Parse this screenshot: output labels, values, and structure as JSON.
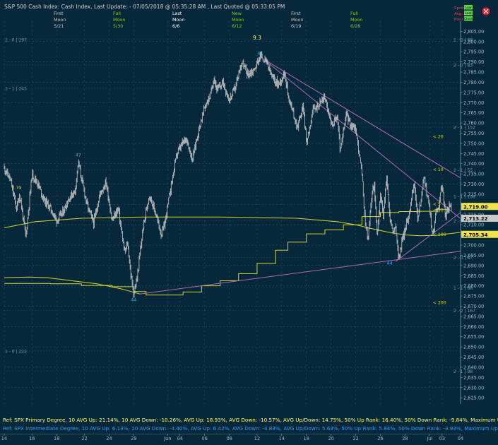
{
  "header": {
    "title": "S&P 500 Cash Index:  Cash Index,  Last Update:  - 07/05/2018 @ 05:35:28 AM , Last Quoted @ 05:33:05 PM",
    "phases": [
      {
        "top": "First",
        "mid": "Moon",
        "date": "5/21",
        "color": "#c9c9c9"
      },
      {
        "top": "Full",
        "mid": "Moon",
        "date": "5/30",
        "color": "#7ed321"
      },
      {
        "top": "Last",
        "mid": "Moon",
        "date": "6/6",
        "color": "#ffffff"
      },
      {
        "top": "New",
        "mid": "Moon",
        "date": "6/12",
        "color": "#7ed321"
      },
      {
        "top": "First",
        "mid": "Moon",
        "date": "6/19",
        "color": "#c9c9c9"
      },
      {
        "top": "Full",
        "mid": "Moon",
        "date": "6/28",
        "color": "#7ed321"
      }
    ],
    "corner_labels": [
      "Sprd: 0.0",
      "Avg: 0.0",
      "Prev: 0.0"
    ],
    "corner_buttons": [
      "Low",
      "Last",
      "Close"
    ]
  },
  "colors": {
    "background": "#06283a",
    "grid": "#2f5a6e",
    "price": "#c8c8c8",
    "moving_average": "#d7d728",
    "trendline": "#b06ab3",
    "fib_text": "#6fa0b4",
    "footer_primary": "#ffff66",
    "footer_secondary": "#1fa3ff"
  },
  "chart_data": {
    "type": "line",
    "title": "S&P 500 Cash Index",
    "ylim": [
      2615,
      2810
    ],
    "yticks": [
      2620,
      2625,
      2630,
      2635,
      2640,
      2645,
      2650,
      2655,
      2660,
      2665,
      2670,
      2675,
      2680,
      2685,
      2690,
      2695,
      2700,
      2705,
      2710,
      2715,
      2720,
      2725,
      2730,
      2735,
      2740,
      2745,
      2750,
      2755,
      2760,
      2765,
      2770,
      2775,
      2780,
      2785,
      2790,
      2795,
      2800,
      2805
    ],
    "ytick_labels": [
      "2,620.00",
      "2,625.00",
      "2,630.00",
      "2,635.00",
      "2,640.00",
      "2,645.00",
      "2,650.00",
      "2,655.00",
      "2,660.00",
      "2,665.00",
      "2,670.00",
      "2,675.00",
      "2,680.00",
      "2,685.00",
      "2,690.00",
      "2,695.00",
      "2,700.00",
      "2,705.00",
      "2,710.00",
      "2,715.00",
      "2,720.00",
      "2,725.00",
      "2,730.00",
      "2,735.00",
      "2,740.00",
      "2,745.00",
      "2,750.00",
      "2,755.00",
      "2,760.00",
      "2,765.00",
      "2,770.00",
      "2,775.00",
      "2,780.00",
      "2,785.00",
      "2,790.00",
      "2,795.00",
      "2,800.00",
      "2,805.00"
    ],
    "xlim": [
      0,
      148
    ],
    "xticks": [
      {
        "x": 0,
        "label": "14"
      },
      {
        "x": 9,
        "label": "16"
      },
      {
        "x": 17,
        "label": "18"
      },
      {
        "x": 26,
        "label": "22"
      },
      {
        "x": 34,
        "label": "24"
      },
      {
        "x": 42,
        "label": "29"
      },
      {
        "x": 53,
        "label": "Jun"
      },
      {
        "x": 57,
        "label": "04"
      },
      {
        "x": 65,
        "label": "06"
      },
      {
        "x": 73,
        "label": "08"
      },
      {
        "x": 82,
        "label": "12"
      },
      {
        "x": 90,
        "label": "14"
      },
      {
        "x": 98,
        "label": "18"
      },
      {
        "x": 106,
        "label": "20"
      },
      {
        "x": 114,
        "label": "22"
      },
      {
        "x": 122,
        "label": "26"
      },
      {
        "x": 130,
        "label": "28"
      },
      {
        "x": 138,
        "label": "Jul"
      },
      {
        "x": 142,
        "label": "03"
      },
      {
        "x": 148,
        "label": "04"
      }
    ],
    "price_anchors": [
      [
        0,
        2738
      ],
      [
        2,
        2732
      ],
      [
        4,
        2718
      ],
      [
        5,
        2725
      ],
      [
        7,
        2704
      ],
      [
        9,
        2735
      ],
      [
        11,
        2730
      ],
      [
        13,
        2722
      ],
      [
        15,
        2718
      ],
      [
        17,
        2712
      ],
      [
        19,
        2716
      ],
      [
        21,
        2723
      ],
      [
        23,
        2727
      ],
      [
        24,
        2741
      ],
      [
        25,
        2733
      ],
      [
        27,
        2719
      ],
      [
        29,
        2711
      ],
      [
        31,
        2725
      ],
      [
        33,
        2731
      ],
      [
        35,
        2712
      ],
      [
        37,
        2718
      ],
      [
        39,
        2696
      ],
      [
        40,
        2701
      ],
      [
        41,
        2686
      ],
      [
        42,
        2676
      ],
      [
        43,
        2683
      ],
      [
        45,
        2708
      ],
      [
        47,
        2725
      ],
      [
        49,
        2716
      ],
      [
        51,
        2705
      ],
      [
        52,
        2710
      ],
      [
        54,
        2728
      ],
      [
        56,
        2745
      ],
      [
        59,
        2753
      ],
      [
        61,
        2742
      ],
      [
        63,
        2756
      ],
      [
        65,
        2768
      ],
      [
        67,
        2774
      ],
      [
        68,
        2783
      ],
      [
        69,
        2776
      ],
      [
        71,
        2780
      ],
      [
        73,
        2771
      ],
      [
        75,
        2778
      ],
      [
        77,
        2790
      ],
      [
        79,
        2784
      ],
      [
        81,
        2786
      ],
      [
        83,
        2793
      ],
      [
        85,
        2790
      ],
      [
        87,
        2782
      ],
      [
        89,
        2779
      ],
      [
        91,
        2785
      ],
      [
        92,
        2774
      ],
      [
        95,
        2758
      ],
      [
        97,
        2768
      ],
      [
        98,
        2750
      ],
      [
        100,
        2766
      ],
      [
        102,
        2769
      ],
      [
        104,
        2773
      ],
      [
        106,
        2759
      ],
      [
        108,
        2763
      ],
      [
        109,
        2746
      ],
      [
        111,
        2765
      ],
      [
        112,
        2760
      ],
      [
        114,
        2757
      ],
      [
        116,
        2735
      ],
      [
        117,
        2712
      ],
      [
        118,
        2703
      ],
      [
        119,
        2722
      ],
      [
        120,
        2731
      ],
      [
        121,
        2703
      ],
      [
        122,
        2725
      ],
      [
        123,
        2715
      ],
      [
        124,
        2734
      ],
      [
        125,
        2714
      ],
      [
        126,
        2707
      ],
      [
        127,
        2708
      ],
      [
        128,
        2693
      ],
      [
        129,
        2702
      ],
      [
        131,
        2713
      ],
      [
        133,
        2731
      ],
      [
        134,
        2713
      ],
      [
        135,
        2720
      ],
      [
        136,
        2734
      ],
      [
        138,
        2718
      ],
      [
        139,
        2704
      ],
      [
        140,
        2716
      ],
      [
        141,
        2720
      ],
      [
        142,
        2731
      ],
      [
        143,
        2714
      ],
      [
        144,
        2718
      ],
      [
        145,
        2719
      ]
    ],
    "overlays": [
      {
        "name": "long-term moving average",
        "points": [
          [
            0,
            2708.5
          ],
          [
            10,
            2711.5
          ],
          [
            25,
            2713.2
          ],
          [
            45,
            2713.8
          ],
          [
            70,
            2713.8
          ],
          [
            95,
            2713.2
          ],
          [
            108,
            2711.5
          ],
          [
            114,
            2710
          ],
          [
            118,
            2708.5
          ],
          [
            124,
            2706.5
          ],
          [
            130,
            2705
          ],
          [
            135,
            2704.6
          ],
          [
            140,
            2704.8
          ],
          [
            148,
            2706.3
          ]
        ]
      },
      {
        "name": "step moving average",
        "points": [
          [
            0,
            2681.2
          ],
          [
            15,
            2681
          ],
          [
            25,
            2680.2
          ],
          [
            35,
            2679.6
          ],
          [
            42,
            2677.2
          ],
          [
            46,
            2675.5
          ],
          [
            52,
            2675.5
          ],
          [
            58,
            2677
          ],
          [
            64,
            2680
          ],
          [
            70,
            2682.5
          ],
          [
            76,
            2686
          ],
          [
            82,
            2691
          ],
          [
            88,
            2697.5
          ],
          [
            92,
            2701.5
          ],
          [
            98,
            2705.5
          ],
          [
            104,
            2707.5
          ],
          [
            110,
            2710
          ],
          [
            116,
            2714
          ],
          [
            122,
            2716
          ],
          [
            128,
            2716.5
          ],
          [
            134,
            2716.6
          ],
          [
            140,
            2717.6
          ],
          [
            144,
            2718.5
          ]
        ]
      },
      {
        "name": "wavy envelope",
        "points": [
          [
            0,
            2684
          ],
          [
            8,
            2684.3
          ],
          [
            14,
            2684
          ],
          [
            22,
            2682.5
          ],
          [
            30,
            2681
          ],
          [
            38,
            2678.5
          ],
          [
            44,
            2676
          ]
        ]
      },
      {
        "name": "declining trendline",
        "color": "trendline",
        "points": [
          [
            84,
            2791.5
          ],
          [
            148,
            2713
          ]
        ]
      },
      {
        "name": "upper trendline",
        "color": "trendline",
        "points": [
          [
            84,
            2791.5
          ],
          [
            148,
            2733
          ]
        ]
      },
      {
        "name": "rising trendline",
        "color": "trendline",
        "points": [
          [
            44,
            2676
          ],
          [
            148,
            2697
          ]
        ]
      },
      {
        "name": "converging trendline",
        "color": "trendline",
        "points": [
          [
            127,
            2692
          ],
          [
            148,
            2716
          ]
        ]
      }
    ],
    "annotations": [
      {
        "text": "9.3",
        "x": 82,
        "y": 2801,
        "color": "#ffff66"
      },
      {
        "text": "44",
        "x": 83,
        "y": 2793.5,
        "color": "#39b4ff"
      },
      {
        "text": "47",
        "x": 24,
        "y": 2743.5,
        "color": "#39b4ff"
      },
      {
        "text": "44",
        "x": 42,
        "y": 2672.5,
        "color": "#39b4ff"
      },
      {
        "text": "44",
        "x": 125,
        "y": 2690.5,
        "color": "#39b4ff"
      },
      {
        "text": "2.79",
        "x": 4,
        "y": 2727.5,
        "color": "#d7d728"
      },
      {
        "text": "< 20",
        "x": 139,
        "y": 2752.5,
        "color": "#d7d728"
      },
      {
        "text": "< 10",
        "x": 139,
        "y": 2736.5,
        "color": "#d7d728"
      },
      {
        "text": "< 5",
        "x": 139,
        "y": 2719.5,
        "color": "#d7d728"
      },
      {
        "text": "< 50",
        "x": 139,
        "y": 2716.5,
        "color": "#d7d728"
      },
      {
        "text": "< 100",
        "x": 139,
        "y": 2704.5,
        "color": "#d7d728"
      },
      {
        "text": "< 200",
        "x": 139,
        "y": 2671,
        "color": "#d7d728"
      }
    ],
    "fib_levels": [
      {
        "left": "1 - 0 | 197",
        "right": "1 - 0 | 68",
        "y": 2801
      },
      {
        "left": "",
        "right": "2 - 0 | 83",
        "y": 2788.5
      },
      {
        "left": "1 - 1 | 245",
        "right": "",
        "y": 2777
      },
      {
        "left": "",
        "right": "2 - 1 | 152",
        "y": 2758
      },
      {
        "left": "",
        "right": "2 - 1 | 55",
        "y": 2737
      },
      {
        "left": "",
        "right": "1 - 1 | 108",
        "y": 2724
      },
      {
        "left": "",
        "right": "2 - 0 | 151",
        "y": 2712
      },
      {
        "left": "",
        "right": "2 - 0 | 87",
        "y": 2694
      },
      {
        "left": "",
        "right": "1 - 1 | 68",
        "y": 2679
      },
      {
        "left": "",
        "right": "2 - 2 | 167",
        "y": 2668
      },
      {
        "left": "1 - 0 | 222",
        "right": "",
        "y": 2648
      },
      {
        "left": "",
        "right": "2 - 1 | 98",
        "y": 2638
      }
    ],
    "price_tags": [
      {
        "label": "2,719.00",
        "y": 2719,
        "bg": "#f2e24a",
        "fg": "#000000"
      },
      {
        "label": "2,713.22",
        "y": 2713.2,
        "bg": "#c8c8c8",
        "fg": "#000000"
      },
      {
        "label": "2,705.34",
        "y": 2705.3,
        "bg": "#f2e24a",
        "fg": "#000000"
      }
    ]
  },
  "footer": {
    "line1": "Ref: SPX Primary Degree, 10 AVG Up: 21.14%, 10 AVG Down: -10.26%, AVG Up: 18.93%, AVG Down: -10.57%, AVG Up/Down: 14.75%, 50%  Up Rank: 16.40%, 50% Down Rank: -9.84%, Maximum Up: 58.71%, Maximum",
    "line2": "Ref: SPX Intermediate Degree, 10 AVG Up: 6.13%, 10 AVG Down: -4.40%, AVG Up: 6.42%, AVG Down: -4.83%, AVG Up/Down: 5.63%, 50%  Up Rank: 5.84%, 50% Down Rank: -3.93%, Maximum Up: 20.27%, Maximum Do"
  }
}
